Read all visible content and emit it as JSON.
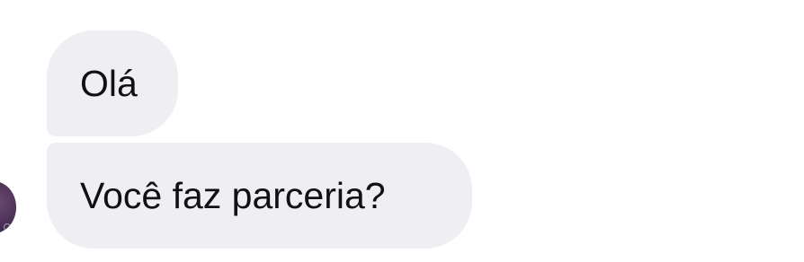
{
  "conversation": {
    "messages": [
      {
        "text": "Olá"
      },
      {
        "text": "Você faz parceria?"
      }
    ]
  },
  "colors": {
    "bubble_background": "#efeff3",
    "message_text": "#111111",
    "page_background": "#ffffff",
    "avatar": "#4a2f55"
  },
  "icons": {
    "avatar": "contact-avatar"
  }
}
